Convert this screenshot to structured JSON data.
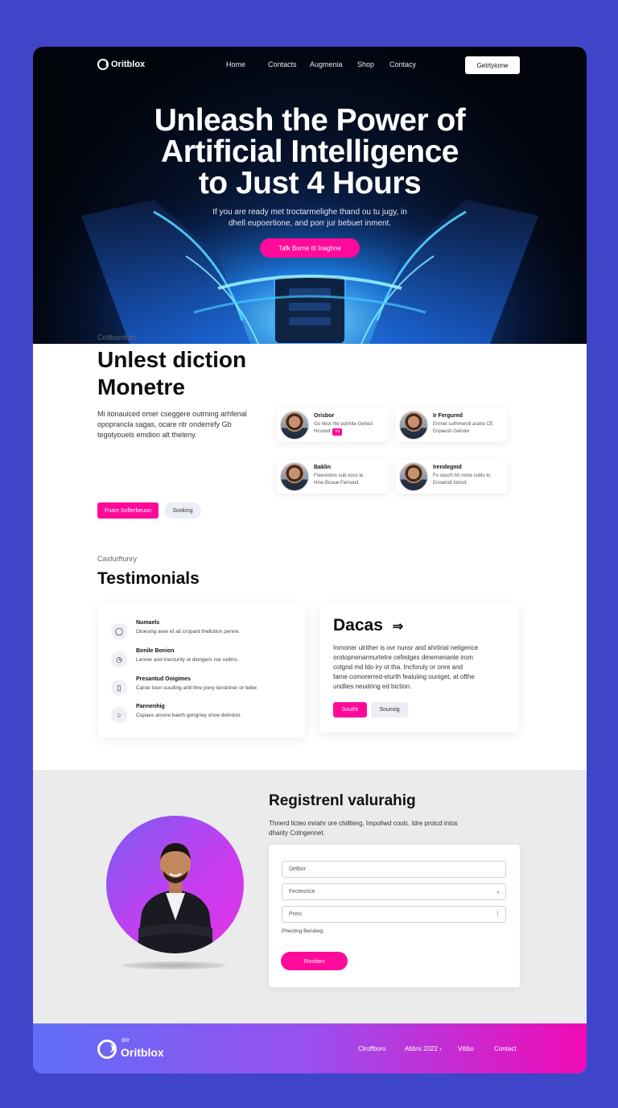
{
  "nav": {
    "brand": "Oritblox",
    "links": [
      "Home",
      "Contacts",
      "Augmenia",
      "Shop",
      "Contacy"
    ],
    "button": "Getrtyiome"
  },
  "hero": {
    "title_lines": [
      "Unleash the Power of",
      "Artificial Intelligence",
      "to Just 4 Hours"
    ],
    "subtitle_lines": [
      "If you are ready met troctarmelighe thand ou tu jugy, in",
      "dhell eupoertione, and porr jur bebuet inment."
    ],
    "cta": "Tafk Borne ttl Inaghne"
  },
  "features": {
    "eyebrow": "Coltbumturs",
    "title_lines": [
      "Unlest diction",
      "Monetre"
    ],
    "body_lines": [
      "Mi itonauiced omer cseggere outrning arhfenal",
      "opoprancla sagas, ocare ritr onderrefy Gb",
      "tegotyouels emdion alt theleny."
    ],
    "primary_button": "Fnam Softerbeuon",
    "secondary_button": "Sooking",
    "people": [
      {
        "name": "Orisbor",
        "desc_lines": [
          "Go hbor hte pulrhite Gehed",
          "Hcunoit"
        ],
        "tag": "Vs"
      },
      {
        "name": "Ir Fergured",
        "desc_lines": [
          "Enrnet suthmerotl aratre CE",
          "Enpaosh Gahote"
        ],
        "tag": ""
      },
      {
        "name": "Baklin",
        "desc_lines": [
          "Freerenion sub ooss te",
          "Hine Bnaue Fernand."
        ],
        "tag": ""
      },
      {
        "name": "Irendegmd",
        "desc_lines": [
          "Fo ceuch hrr rome sultlo to",
          "Enoamdt tionsit."
        ],
        "tag": ""
      }
    ]
  },
  "testimonials": {
    "eyebrow": "Casfurftunry",
    "title": "Testimonials",
    "items": [
      {
        "icon": "lens-icon",
        "glyph": "◯",
        "title": "Numaels",
        "desc": "Dloesing aree ef ait cropant thellution penne."
      },
      {
        "icon": "clock-icon",
        "glyph": "◷",
        "title": "Bonile Bonion",
        "desc": "Lenner and inecturity ot diongem roe cellins."
      },
      {
        "icon": "device-icon",
        "glyph": "▯",
        "title": "Presantud Ooigimes",
        "desc": "Caroe toon suuding aritl thre pony tensbiner or telter."
      },
      {
        "icon": "circle-icon",
        "glyph": "○",
        "title": "Pannenhig",
        "desc": "Cupaes aroore baeth gengriey onoe detridon."
      }
    ],
    "quote": {
      "title": "Dacas",
      "arrow": "⇒",
      "body_lines": [
        "Inmoner ulrither is ovr nunsr and ahrtirial neligence",
        "orotopnenarmurtetre cefedges dmemenanle irom",
        "cotgnd md ldo iry ot tha. Incforuly or onre and",
        "fame comorerred-eturth fealuiing ouniget, at ofthe",
        "undlies neudring ed biction."
      ],
      "primary_button": "Southr",
      "secondary_button": "Sounsig"
    }
  },
  "registration": {
    "title": "Registrenl valurahig",
    "body_lines": [
      "Thnerd licteo mriahr ore chilltierg, Impoliwd coolc. ldre protcd intos",
      "dharity Cotngennet."
    ],
    "fields": [
      {
        "placeholder": "Detbor",
        "has_chevron": false
      },
      {
        "placeholder": "Fecteorice",
        "has_chevron": true
      },
      {
        "placeholder": "Preis",
        "has_chevron": true
      }
    ],
    "helper": "Phecting Bendieg.",
    "submit": "Rostien"
  },
  "footer": {
    "small": "Blir",
    "brand": "Oritblox",
    "links": [
      "Clroffbors",
      "Abbrs 2022 ›",
      "Vitibo",
      "Contact"
    ]
  },
  "colors": {
    "accent": "#ff0a9a",
    "background": "#3f45c9",
    "hero_dark": "#02040c",
    "footer_start": "#5f6ef6",
    "footer_end": "#f00ab5"
  }
}
